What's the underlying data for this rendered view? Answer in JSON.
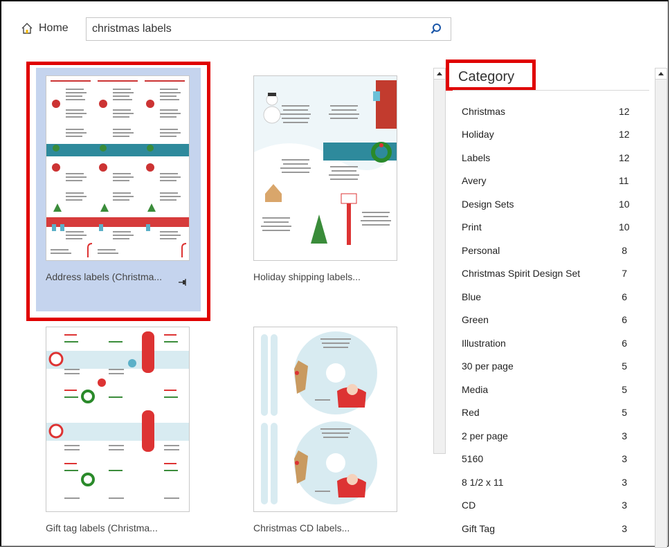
{
  "nav": {
    "home_label": "Home"
  },
  "search": {
    "value": "christmas labels"
  },
  "templates": [
    {
      "title": "Address labels (Christma..."
    },
    {
      "title": "Holiday shipping labels..."
    },
    {
      "title": "Gift tag labels (Christma..."
    },
    {
      "title": "Christmas CD labels..."
    }
  ],
  "category": {
    "title": "Category",
    "items": [
      {
        "label": "Christmas",
        "count": "12"
      },
      {
        "label": "Holiday",
        "count": "12"
      },
      {
        "label": "Labels",
        "count": "12"
      },
      {
        "label": "Avery",
        "count": "11"
      },
      {
        "label": "Design Sets",
        "count": "10"
      },
      {
        "label": "Print",
        "count": "10"
      },
      {
        "label": "Personal",
        "count": "8"
      },
      {
        "label": "Christmas Spirit Design Set",
        "count": "7"
      },
      {
        "label": "Blue",
        "count": "6"
      },
      {
        "label": "Green",
        "count": "6"
      },
      {
        "label": "Illustration",
        "count": "6"
      },
      {
        "label": "30 per page",
        "count": "5"
      },
      {
        "label": "Media",
        "count": "5"
      },
      {
        "label": "Red",
        "count": "5"
      },
      {
        "label": "2 per page",
        "count": "3"
      },
      {
        "label": "5160",
        "count": "3"
      },
      {
        "label": "8 1/2 x 11",
        "count": "3"
      },
      {
        "label": "CD",
        "count": "3"
      },
      {
        "label": "Gift Tag",
        "count": "3"
      }
    ]
  },
  "colors": {
    "highlight": "#e00000",
    "selection": "#c5d4ee",
    "accent_blue": "#1a56a8"
  }
}
